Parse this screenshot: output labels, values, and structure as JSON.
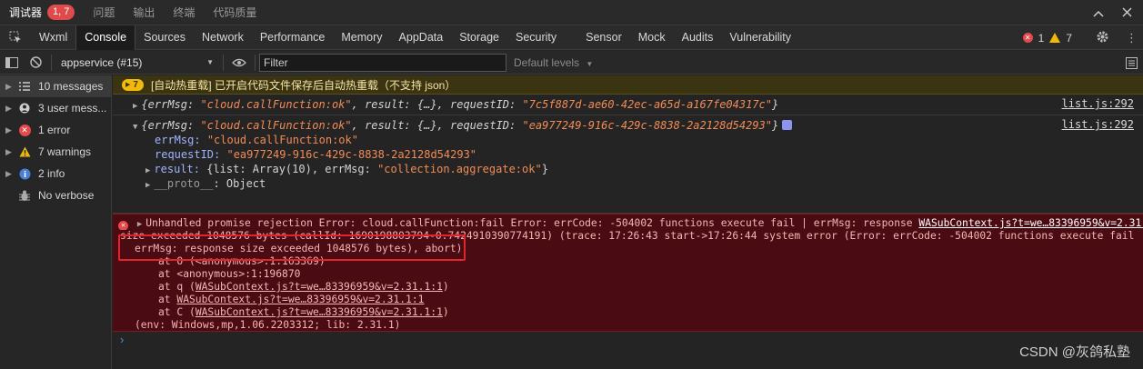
{
  "top_tabs": [
    {
      "label": "调试器",
      "badge": "1, 7",
      "active": true
    },
    {
      "label": "问题"
    },
    {
      "label": "输出"
    },
    {
      "label": "终端"
    },
    {
      "label": "代码质量"
    }
  ],
  "devtools_tabs": [
    "Wxml",
    "Console",
    "Sources",
    "Network",
    "Performance",
    "Memory",
    "AppData",
    "Storage",
    "Security",
    "Sensor",
    "Mock",
    "Audits",
    "Vulnerability"
  ],
  "status": {
    "errors": "1",
    "warnings": "7"
  },
  "toolbar": {
    "context": "appservice (#15)",
    "filter_placeholder": "Filter",
    "levels": "Default levels"
  },
  "sidebar": [
    {
      "label": "10 messages",
      "icon": "list-icon"
    },
    {
      "label": "3 user mess...",
      "icon": "user-icon"
    },
    {
      "label": "1 error",
      "icon": "error-icon"
    },
    {
      "label": "7 warnings",
      "icon": "warning-icon"
    },
    {
      "label": "2 info",
      "icon": "info-icon"
    },
    {
      "label": "No verbose",
      "icon": "bug-icon"
    }
  ],
  "log": {
    "warn": {
      "count": "7",
      "text": "[自动热重载] 已开启代码文件保存后自动热重载（不支持 json）"
    },
    "obj1": {
      "open": "{errMsg: ",
      "errMsg": "\"cloud.callFunction:ok\"",
      "mid": ", result: {…}, requestID: ",
      "requestID": "\"7c5f887d-ae60-42ec-a65d-a167fe04317c\"",
      "close": "}",
      "source": "list.js:292"
    },
    "obj2": {
      "open": "{errMsg: ",
      "errMsg": "\"cloud.callFunction:ok\"",
      "mid": ", result: {…}, requestID: ",
      "requestID": "\"ea977249-916c-429c-8838-2a2128d54293\"",
      "close": "}",
      "source": "list.js:292",
      "field_errMsg_key": "errMsg:",
      "field_errMsg_val": "\"cloud.callFunction:ok\"",
      "field_requestID_key": "requestID:",
      "field_requestID_val": "\"ea977249-916c-429c-8838-2a2128d54293\"",
      "field_result_key": "result:",
      "field_result_val": " {list: Array(10), errMsg: ",
      "field_result_str": "\"collection.aggregate:ok\"",
      "field_result_end": "}",
      "field_proto_key": "__proto__",
      "field_proto_val": ": Object"
    },
    "error": {
      "line1": "Unhandled promise rejection Error: cloud.callFunction:fail Error: errCode: -504002 functions execute fail | errMsg: response ",
      "source": "WASubContext.js?t=we…83396959&v=2.31.1:1",
      "line2": "size exceeded 1048576 bytes (callId: 1690198803794-0.7424910390774191) (trace: 17:26:43 start->17:26:44 system error (Error: errCode: -504002 functions execute fail |",
      "line3": "errMsg: response size exceeded 1048576 bytes), abort)",
      "line4": "at O (<anonymous>:1:163369)",
      "line5": "at <anonymous>:1:196870",
      "line6_pre": "at q (",
      "line6_link": "WASubContext.js?t=we…83396959&v=2.31.1:1",
      "line6_post": ")",
      "line7_pre": "at ",
      "line7_link": "WASubContext.js?t=we…83396959&v=2.31.1:1",
      "line8_pre": "at C (",
      "line8_link": "WASubContext.js?t=we…83396959&v=2.31.1:1",
      "line8_post": ")",
      "line9": "(env: Windows,mp,1.06.2203312; lib: 2.31.1)"
    },
    "prompt": "›"
  },
  "watermark": "CSDN @灰鸽私塾",
  "colors": {
    "error_bg": "#4a0c12",
    "warn_bg": "#3b3412",
    "highlight": "#e0262d"
  }
}
